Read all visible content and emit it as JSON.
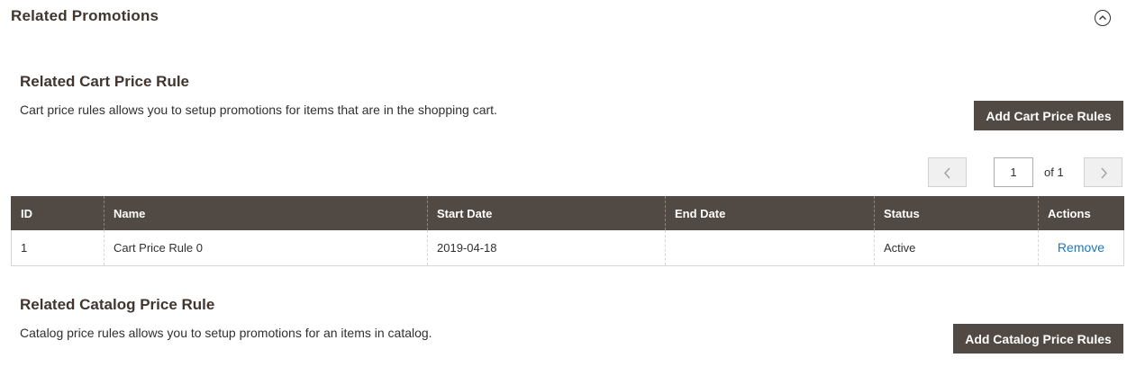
{
  "section": {
    "title": "Related Promotions",
    "collapse_icon": "collapse-up-icon"
  },
  "cart": {
    "title": "Related Cart Price Rule",
    "description": "Cart price rules allows you to setup promotions for items that are in the shopping cart.",
    "add_button": "Add Cart Price Rules",
    "pager": {
      "current_page": "1",
      "of_label": "of 1",
      "prev_icon": "chevron-left-icon",
      "next_icon": "chevron-right-icon"
    },
    "columns": [
      "ID",
      "Name",
      "Start Date",
      "End Date",
      "Status",
      "Actions"
    ],
    "rows": [
      {
        "id": "1",
        "name": "Cart Price Rule 0",
        "start_date": "2019-04-18",
        "end_date": "",
        "status": "Active",
        "action": "Remove"
      }
    ]
  },
  "catalog": {
    "title": "Related Catalog Price Rule",
    "description": "Catalog price rules allows you to setup promotions for an items in catalog.",
    "add_button": "Add Catalog Price Rules"
  },
  "colors": {
    "header_bg": "#514943",
    "button_bg": "#514943",
    "link": "#1979c3",
    "title": "#41362f"
  }
}
